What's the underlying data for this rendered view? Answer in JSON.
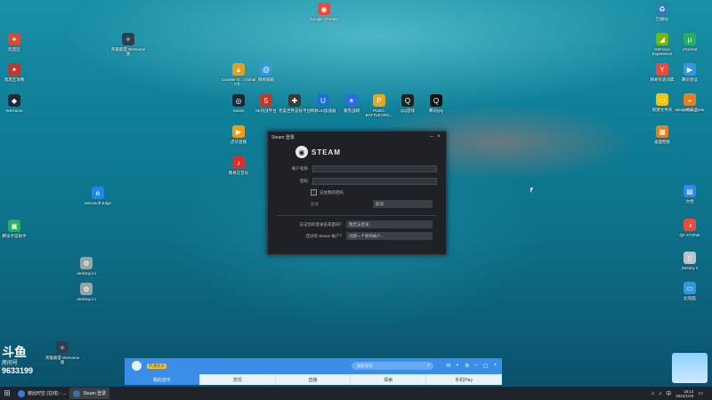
{
  "desktop": {
    "icons": [
      {
        "label": "Google Chrome",
        "color": "#e74c3c",
        "glyph": "◉"
      },
      {
        "label": "暗黑区",
        "color": "#d54c3a",
        "glyph": "✦"
      },
      {
        "label": "英雄联盟 WeGame版",
        "color": "#2c3e50",
        "glyph": "✧"
      },
      {
        "label": "暗黑区攻略",
        "color": "#c0392b",
        "glyph": "✦"
      },
      {
        "label": "WeGame",
        "color": "#1f2a3a",
        "glyph": "◆"
      },
      {
        "label": "Counter-S... Global Off...",
        "color": "#e0a020",
        "glyph": "▲"
      },
      {
        "label": "网易邮箱",
        "color": "#3498db",
        "glyph": "@"
      },
      {
        "label": "Steam",
        "color": "#1b2838",
        "glyph": "◎"
      },
      {
        "label": "5E对战平台",
        "color": "#c0392b",
        "glyph": "5"
      },
      {
        "label": "完美世界竞技平台",
        "color": "#3a3a3a",
        "glyph": "✚"
      },
      {
        "label": "网易UU加速器",
        "color": "#1f6fd1",
        "glyph": "U"
      },
      {
        "label": "暴雪战网",
        "color": "#2d6cdf",
        "glyph": "✴"
      },
      {
        "label": "PUBG: BATTLEGRO...",
        "color": "#e5a623",
        "glyph": "P"
      },
      {
        "label": "QQ游戏",
        "color": "#222",
        "glyph": "Q"
      },
      {
        "label": "腾讯QQ",
        "color": "#111",
        "glyph": "Q"
      },
      {
        "label": "虎牙直播",
        "color": "#f39c12",
        "glyph": "▶"
      },
      {
        "label": "网易云音乐",
        "color": "#d63031",
        "glyph": "♪"
      },
      {
        "label": "Microsoft Edge",
        "color": "#1e88e5",
        "glyph": "e"
      },
      {
        "label": "腾讯手游助手",
        "color": "#27ae60",
        "glyph": "▣"
      },
      {
        "label": "desktop.ini",
        "color": "#95a5a6",
        "glyph": "⚙"
      },
      {
        "label": "desktop.ini",
        "color": "#95a5a6",
        "glyph": "⚙"
      },
      {
        "label": "英雄联盟 WeGame版",
        "color": "#2c3e50",
        "glyph": "✧"
      },
      {
        "label": "回收站",
        "color": "#2980b9",
        "glyph": "♻"
      },
      {
        "label": "GeForce Experience",
        "color": "#76b900",
        "glyph": "◢"
      },
      {
        "label": "uTorrent",
        "color": "#27ae60",
        "glyph": "μ"
      },
      {
        "label": "网易有道词典",
        "color": "#e74c3c",
        "glyph": "Y"
      },
      {
        "label": "腾讯会议",
        "color": "#3498db",
        "glyph": "▶"
      },
      {
        "label": "Internet Explorer",
        "color": "#1e88e5",
        "glyph": "e"
      },
      {
        "label": "新建文件夹",
        "color": "#f1c40f",
        "glyph": "▭"
      },
      {
        "label": "火绒安全",
        "color": "#e67e22",
        "glyph": "◒"
      },
      {
        "label": "桌面壁纸",
        "color": "#e67e22",
        "glyph": "▦"
      },
      {
        "label": "文档",
        "color": "#2d89ef",
        "glyph": "▤"
      },
      {
        "label": "QF STONE",
        "color": "#e74c3c",
        "glyph": "◑"
      },
      {
        "label": "Destiny 2",
        "color": "#bdc3c7",
        "glyph": "▯"
      },
      {
        "label": "此电脑",
        "color": "#3498db",
        "glyph": "▭"
      }
    ]
  },
  "steam_login": {
    "window_title": "Steam 登录",
    "brand": "STEAM",
    "account_label": "帐户名称",
    "password_label": "密码",
    "remember_label": "记住我的密码",
    "login_hint": "登录",
    "cancel_button": "取消",
    "forgot_question": "忘记您的登录名或密码？",
    "forgot_button": "我无法登录…",
    "no_account_question": "还没有 Steam 帐户？",
    "create_account_button": "创建一个新的帐户…"
  },
  "douyu": {
    "logo": "斗鱼",
    "room_label": "房间号",
    "room_number": "9633199"
  },
  "music_player": {
    "badge": "开通会员",
    "search_placeholder": "搜索音乐",
    "tabs": [
      "我的音乐",
      "发现",
      "直播",
      "探索",
      "手机Play"
    ]
  },
  "taskbar": {
    "tasks": [
      {
        "label": "彼此时空 (在线) - ...",
        "color": "#2b7de9"
      },
      {
        "label": "Steam 登录",
        "color": "#3d6ea7"
      }
    ],
    "tray": {
      "lang": "中",
      "time": "18:14",
      "date": "2021/1/20"
    }
  }
}
